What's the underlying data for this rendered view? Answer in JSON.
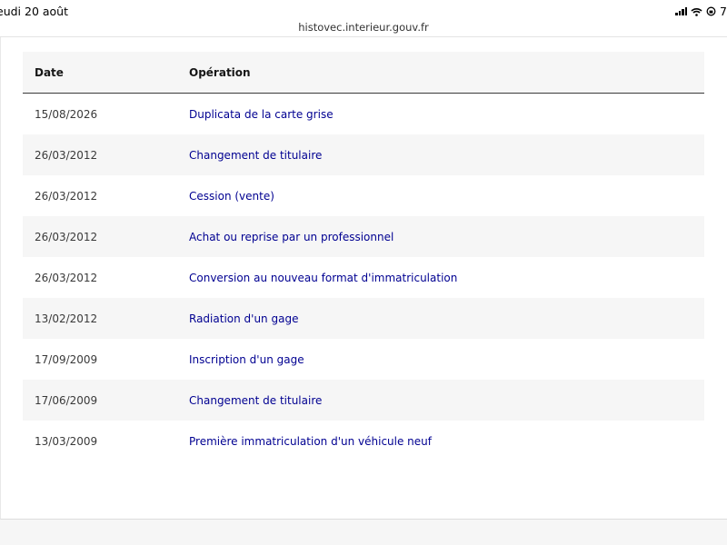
{
  "status_bar": {
    "time_label": "eudi 20 août",
    "battery_label": "7"
  },
  "browser": {
    "url": "histovec.interieur.gouv.fr"
  },
  "history_table": {
    "headers": {
      "date": "Date",
      "operation": "Opération"
    },
    "rows": [
      {
        "date": "15/08/2026",
        "operation": "Duplicata de la carte grise"
      },
      {
        "date": "26/03/2012",
        "operation": "Changement de titulaire"
      },
      {
        "date": "26/03/2012",
        "operation": "Cession (vente)"
      },
      {
        "date": "26/03/2012",
        "operation": "Achat ou reprise par un professionnel"
      },
      {
        "date": "26/03/2012",
        "operation": "Conversion au nouveau format d'immatriculation"
      },
      {
        "date": "13/02/2012",
        "operation": "Radiation d'un gage"
      },
      {
        "date": "17/09/2009",
        "operation": "Inscription d'un gage"
      },
      {
        "date": "17/06/2009",
        "operation": "Changement de titulaire"
      },
      {
        "date": "13/03/2009",
        "operation": "Première immatriculation d'un véhicule neuf"
      }
    ]
  },
  "colors": {
    "link": "#000091",
    "header_bg": "#f6f6f6",
    "alt_row_bg": "#f6f6f6",
    "header_border": "#3a3a3a"
  }
}
